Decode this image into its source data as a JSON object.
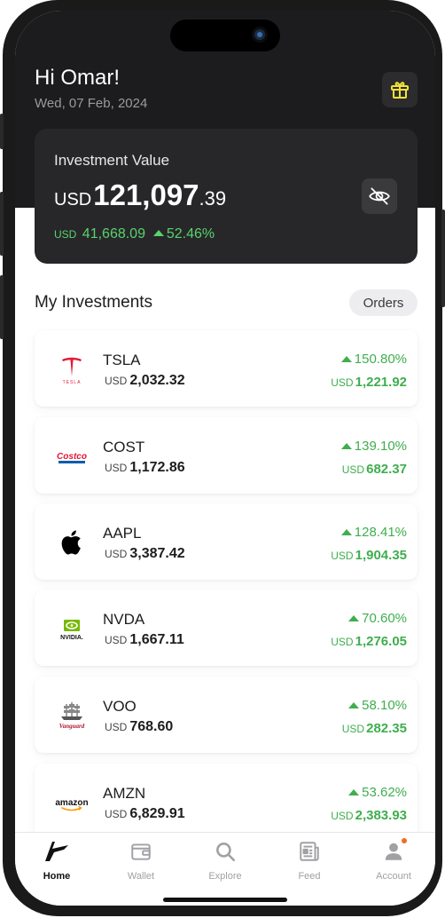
{
  "header": {
    "greeting": "Hi Omar!",
    "date": "Wed, 07 Feb, 2024"
  },
  "investment": {
    "title": "Investment Value",
    "currency": "USD",
    "value_int": "121,097",
    "value_dec": ".39",
    "gain_currency": "USD",
    "gain_amount": "41,668.09",
    "gain_percent": "52.46%"
  },
  "section": {
    "title": "My Investments",
    "orders_label": "Orders"
  },
  "holdings": [
    {
      "ticker": "TSLA",
      "currency": "USD",
      "price": "2,032.32",
      "percent": "150.80%",
      "gain": "1,221.92",
      "logo": "tesla-logo"
    },
    {
      "ticker": "COST",
      "currency": "USD",
      "price": "1,172.86",
      "percent": "139.10%",
      "gain": "682.37",
      "logo": "costco-logo"
    },
    {
      "ticker": "AAPL",
      "currency": "USD",
      "price": "3,387.42",
      "percent": "128.41%",
      "gain": "1,904.35",
      "logo": "apple-logo"
    },
    {
      "ticker": "NVDA",
      "currency": "USD",
      "price": "1,667.11",
      "percent": "70.60%",
      "gain": "1,276.05",
      "logo": "nvidia-logo"
    },
    {
      "ticker": "VOO",
      "currency": "USD",
      "price": "768.60",
      "percent": "58.10%",
      "gain": "282.35",
      "logo": "vanguard-logo"
    },
    {
      "ticker": "AMZN",
      "currency": "USD",
      "price": "6,829.91",
      "percent": "53.62%",
      "gain": "2,383.93",
      "logo": "amazon-logo"
    }
  ],
  "logos": {
    "tesla": "TESLA",
    "costco": "Costco",
    "nvidia": "NVIDIA.",
    "vanguard": "Vanguard",
    "amazon": "amazon"
  },
  "nav": {
    "tabs": [
      {
        "label": "Home",
        "icon": "home-icon",
        "active": true
      },
      {
        "label": "Wallet",
        "icon": "wallet-icon",
        "active": false
      },
      {
        "label": "Explore",
        "icon": "search-icon",
        "active": false
      },
      {
        "label": "Feed",
        "icon": "newspaper-icon",
        "active": false
      },
      {
        "label": "Account",
        "icon": "user-icon",
        "active": false
      }
    ]
  },
  "colors": {
    "header_bg": "#1c1c1e",
    "card_bg": "#27272a",
    "positive": "#3fae4e",
    "positive_dark_bg": "#59d36b",
    "gift_accent": "#f2e335",
    "notification_dot": "#f26b21"
  }
}
